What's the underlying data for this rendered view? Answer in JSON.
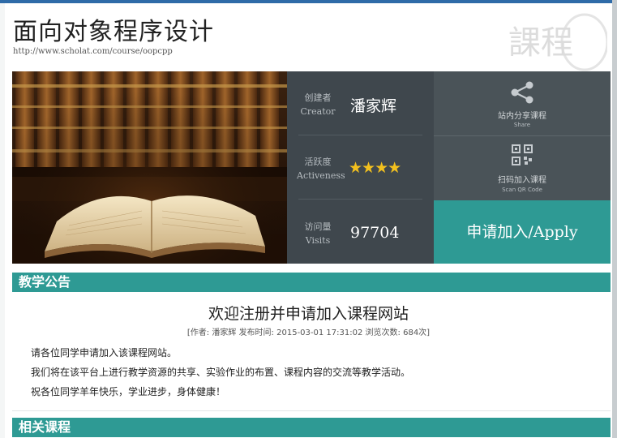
{
  "course": {
    "title": "面向对象程序设计",
    "url": "http://www.scholat.com/course/oopcpp",
    "logo_text": "課程"
  },
  "info": {
    "creator_label_cn": "创建者",
    "creator_label_en": "Creator",
    "creator_name": "潘家辉",
    "activeness_label_cn": "活跃度",
    "activeness_label_en": "Activeness",
    "activeness_stars": "★★★★",
    "activeness_rating": 4,
    "visits_label_cn": "访问量",
    "visits_label_en": "Visits",
    "visits_value": "97704"
  },
  "actions": {
    "share_icon": "share-icon",
    "share_label": "站内分享课程",
    "share_sub": "Share",
    "qr_icon": "qr-code-icon",
    "qr_label": "扫码加入课程",
    "qr_sub": "Scan QR Code",
    "apply_label": "申请加入/Apply"
  },
  "announcements": {
    "section_title": "教学公告",
    "post_title": "欢迎注册并申请加入课程网站",
    "meta_prefix": "[作者:",
    "meta_author": "潘家辉",
    "meta_time_label": "发布时间:",
    "meta_time": "2015-03-01 17:31:02",
    "meta_views_label": "浏览次数:",
    "meta_views": "684次]",
    "body": [
      "请各位同学申请加入该课程网站。",
      "我们将在该平台上进行教学资源的共享、实验作业的布置、课程内容的交流等教学活动。",
      "祝各位同学羊年快乐，学业进步，身体健康！"
    ]
  },
  "related": {
    "section_title": "相关课程"
  },
  "colors": {
    "accent": "#2e9a94",
    "panel_dark": "#3f474d",
    "panel_action": "#4a5358",
    "star": "#f2c01e",
    "topbar": "#2f6ba8"
  }
}
